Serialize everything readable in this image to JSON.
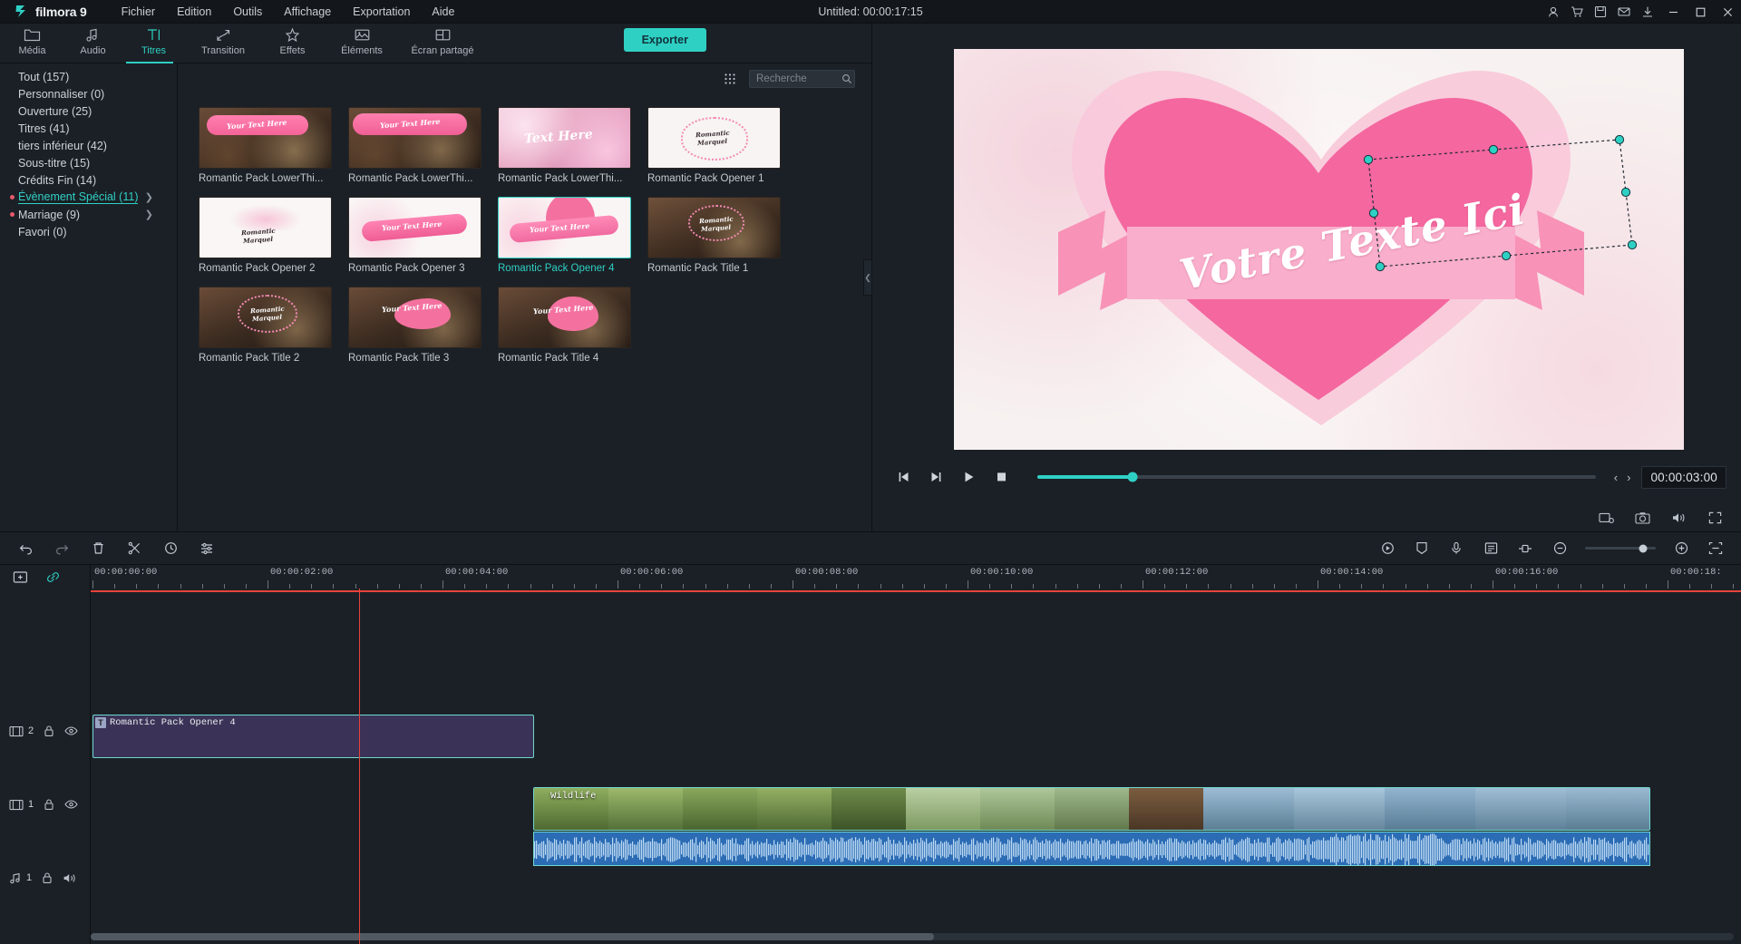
{
  "app": {
    "brand": "filmora 9",
    "title": "Untitled: 00:00:17:15",
    "menu": [
      "Fichier",
      "Edition",
      "Outils",
      "Affichage",
      "Exportation",
      "Aide"
    ],
    "window_controls": [
      "minimize",
      "maximize",
      "close"
    ],
    "titlebar_icons": [
      "account-icon",
      "cart-icon",
      "save-icon",
      "mail-icon",
      "download-icon"
    ]
  },
  "tabs": [
    {
      "label": "Média",
      "icon": "folder-icon",
      "active": false
    },
    {
      "label": "Audio",
      "icon": "music-note-icon",
      "active": false
    },
    {
      "label": "Titres",
      "icon": "text-icon",
      "active": true
    },
    {
      "label": "Transition",
      "icon": "transition-arrows-icon",
      "active": false
    },
    {
      "label": "Effets",
      "icon": "sparkle-icon",
      "active": false
    },
    {
      "label": "Éléments",
      "icon": "image-icon",
      "active": false
    },
    {
      "label": "Écran partagé",
      "icon": "split-screen-icon",
      "active": false
    }
  ],
  "export_button": "Exporter",
  "categories": [
    {
      "label": "Tout (157)",
      "dot": false,
      "chevron": false,
      "selected": false
    },
    {
      "label": "Personnaliser (0)",
      "dot": false,
      "chevron": false,
      "selected": false
    },
    {
      "label": "Ouverture (25)",
      "dot": false,
      "chevron": false,
      "selected": false
    },
    {
      "label": "Titres (41)",
      "dot": false,
      "chevron": false,
      "selected": false
    },
    {
      "label": "tiers inférieur (42)",
      "dot": false,
      "chevron": false,
      "selected": false
    },
    {
      "label": "Sous-titre (15)",
      "dot": false,
      "chevron": false,
      "selected": false
    },
    {
      "label": "Crédits Fin (14)",
      "dot": false,
      "chevron": false,
      "selected": false
    },
    {
      "label": "Évènement Spécial (11)",
      "dot": true,
      "chevron": true,
      "selected": true
    },
    {
      "label": "Marriage (9)",
      "dot": true,
      "chevron": true,
      "selected": false
    },
    {
      "label": "Favori (0)",
      "dot": false,
      "chevron": false,
      "selected": false
    }
  ],
  "search": {
    "placeholder": "Recherche",
    "value": "",
    "icon": "search-icon"
  },
  "grid_view_icon": "grid-view-icon",
  "assets": [
    {
      "label": "Romantic Pack LowerThi...",
      "style": "lower1",
      "selected": false
    },
    {
      "label": "Romantic Pack LowerThi...",
      "style": "lower2",
      "selected": false
    },
    {
      "label": "Romantic Pack LowerThi...",
      "style": "lower3",
      "selected": false
    },
    {
      "label": "Romantic Pack Opener 1",
      "style": "opener1",
      "selected": false
    },
    {
      "label": "Romantic Pack Opener 2",
      "style": "opener2",
      "selected": false
    },
    {
      "label": "Romantic Pack Opener 3",
      "style": "opener3",
      "selected": false
    },
    {
      "label": "Romantic Pack Opener 4",
      "style": "opener4",
      "selected": true
    },
    {
      "label": "Romantic Pack Title 1",
      "style": "title1",
      "selected": false
    },
    {
      "label": "Romantic Pack Title 2",
      "style": "title2",
      "selected": false
    },
    {
      "label": "Romantic Pack Title 3",
      "style": "title3",
      "selected": false
    },
    {
      "label": "Romantic Pack Title 4",
      "style": "title4",
      "selected": false
    }
  ],
  "preview": {
    "canvas_text": "Votre Texte Ici",
    "timecode": "00:00:03:00",
    "progress_percent": 17,
    "controls": [
      {
        "name": "previous-frame-button",
        "icon": "prev-frame-icon"
      },
      {
        "name": "next-frame-button",
        "icon": "next-frame-icon"
      },
      {
        "name": "play-button",
        "icon": "play-icon"
      },
      {
        "name": "stop-button",
        "icon": "stop-icon"
      }
    ],
    "frame_step_back": "‹",
    "frame_step_fwd": "›",
    "bottom_icons": [
      "crop-marker-icon",
      "snapshot-icon",
      "volume-icon",
      "fullscreen-icon"
    ]
  },
  "toolbar": {
    "left_icons": [
      "undo-icon",
      "redo-icon",
      "delete-icon",
      "split-icon",
      "duration-icon",
      "settings-icon"
    ],
    "right_icons": [
      "record-voiceover-icon",
      "marker-icon",
      "microphone-icon",
      "audio-mixer-icon",
      "keyframe-icon"
    ],
    "zoom_out_icon": "zoom-out-icon",
    "zoom_in_icon": "zoom-in-icon",
    "zoom_level_percent": 82,
    "fit_icon": "fit-timeline-icon"
  },
  "timeline": {
    "head_icons": [
      "add-media-icon",
      "link-icon"
    ],
    "ruler_labels": [
      "00:00:00:00",
      "00:00:02:00",
      "00:00:04:00",
      "00:00:06:00",
      "00:00:08:00",
      "00:00:10:00",
      "00:00:12:00",
      "00:00:14:00",
      "00:00:16:00",
      "00:00:18:"
    ],
    "playhead_time": "00:00:02:00",
    "tracks": [
      {
        "number": "2",
        "type": "video",
        "icons": [
          "film-icon",
          "lock-icon",
          "eye-icon"
        ],
        "clip": {
          "name": "Romantic Pack Opener 4",
          "badge": "T",
          "kind": "text"
        }
      },
      {
        "number": "1",
        "type": "video",
        "icons": [
          "film-icon",
          "lock-icon",
          "eye-icon"
        ],
        "clip": {
          "name": "Wildlife",
          "kind": "video"
        }
      },
      {
        "number": "1",
        "type": "audio",
        "icons": [
          "music-icon",
          "lock-icon",
          "speaker-icon"
        ],
        "clip": {
          "name": "",
          "kind": "audio"
        }
      }
    ]
  },
  "colors": {
    "accent": "#2fd0c4",
    "background": "#1b2026",
    "titlebar": "#13171c",
    "playhead": "#e8433a",
    "category_dot": "#e8596b",
    "text_clip": "#3b3357",
    "audio_clip": "#2b6cb5"
  }
}
